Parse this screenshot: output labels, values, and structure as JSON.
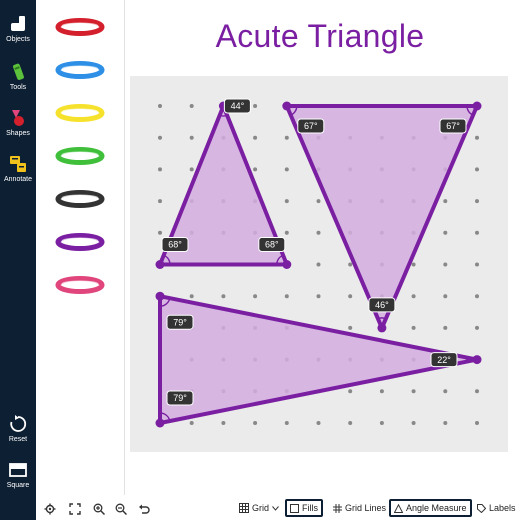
{
  "sidebar": {
    "items": [
      {
        "label": "Objects",
        "icon": "objects-icon"
      },
      {
        "label": "Tools",
        "icon": "tools-icon"
      },
      {
        "label": "Shapes",
        "icon": "shapes-icon"
      },
      {
        "label": "Annotate",
        "icon": "annotate-icon"
      },
      {
        "label": "Reset",
        "icon": "reset-icon"
      },
      {
        "label": "Square",
        "icon": "square-icon"
      }
    ]
  },
  "bands": [
    "#d3202c",
    "#2e8fe6",
    "#f6e22c",
    "#3fbf3a",
    "#333333",
    "#7b1fa2",
    "#e0457b"
  ],
  "page": {
    "title": "Acute Triangle"
  },
  "triangles": [
    {
      "angles": [
        "44°",
        "68°",
        "68°"
      ]
    },
    {
      "angles": [
        "67°",
        "67°",
        "46°"
      ]
    },
    {
      "angles": [
        "79°",
        "79°",
        "22°"
      ]
    }
  ],
  "toolbar": {
    "grid": "Grid",
    "fills": "Fills",
    "gridlines": "Grid Lines",
    "angle_measure": "Angle Measure",
    "labels": "Labels"
  },
  "colors": {
    "accent": "#7b1fa2",
    "fill": "#d4aee0",
    "sidebar": "#0d1f33"
  }
}
